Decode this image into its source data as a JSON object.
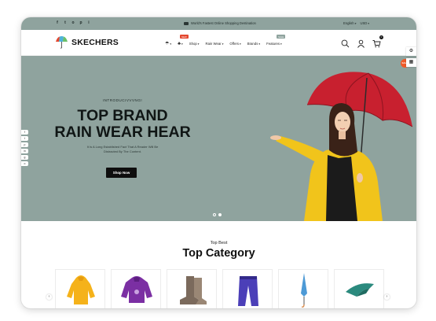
{
  "topbar": {
    "socials": [
      "f",
      "t",
      "o",
      "p",
      "i"
    ],
    "promo": "World's Fastest Online Shopping Destination",
    "language": "English",
    "currency": "USD"
  },
  "header": {
    "logo_text": "SKECHERS",
    "nav": [
      {
        "label": "",
        "icon": "umbrella-icon"
      },
      {
        "label": "",
        "icon": "dress-icon",
        "badge": "NEW"
      },
      {
        "label": "Shop"
      },
      {
        "label": "Rain Wear"
      },
      {
        "label": "Offers"
      },
      {
        "label": "Brands"
      },
      {
        "label": "Features",
        "badge": "SALE"
      }
    ],
    "icons": [
      "search-icon",
      "user-icon",
      "cart-icon"
    ],
    "cart_count": "0"
  },
  "hero": {
    "intro": "INTRODUCIVVVNG!",
    "title_line1": "TOP BRAND",
    "title_line2": "RAIN WEAR HEAR",
    "subtitle_line1": "It Is A Long Established Fact That A Reader Will Be",
    "subtitle_line2": "Distracted By The Content.",
    "button": "Shop Now",
    "side_social": [
      "f",
      "t",
      "p",
      "in",
      "g",
      "o"
    ],
    "slide_dots": 2,
    "active_slide": 2
  },
  "floating": {
    "sale": "SALE",
    "settings": "⚙",
    "grid": "▦"
  },
  "category": {
    "pre_title": "Top Best",
    "title": "Top Category",
    "items": [
      "raincoat",
      "purple-jacket",
      "rain-boots",
      "rain-pants",
      "umbrella",
      "poncho"
    ],
    "prev": "‹",
    "next": "›"
  },
  "colors": {
    "hero_bg": "#8fa39e",
    "button_bg": "#0e0e0e",
    "badge_red": "#e4472f",
    "sale": "#f05a28"
  }
}
